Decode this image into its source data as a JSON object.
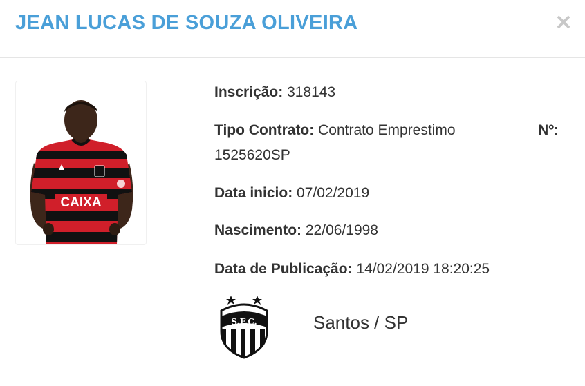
{
  "modal": {
    "title": "JEAN LUCAS DE SOUZA OLIVEIRA",
    "close_symbol": "×",
    "close_icon": "close-icon"
  },
  "player": {
    "photo_icon": "player-photo",
    "jersey_sponsor": "CAIXA",
    "colors": {
      "title": "#4a9fd8",
      "jersey_red": "#d01f2a",
      "jersey_black": "#111111"
    }
  },
  "details": {
    "inscricao_label": "Inscrição:",
    "inscricao_value": "318143",
    "tipo_contrato_label": "Tipo Contrato:",
    "tipo_contrato_value": "Contrato Emprestimo",
    "numero_label": "Nº:",
    "numero_value": "1525620SP",
    "data_inicio_label": "Data inicio:",
    "data_inicio_value": "07/02/2019",
    "nascimento_label": "Nascimento:",
    "nascimento_value": "22/06/1998",
    "data_publicacao_label": "Data de Publicação:",
    "data_publicacao_value": "14/02/2019 18:20:25"
  },
  "club": {
    "logo_icon": "santos-crest-icon",
    "logo_text": "S.F.C.",
    "name": "Santos / SP"
  }
}
